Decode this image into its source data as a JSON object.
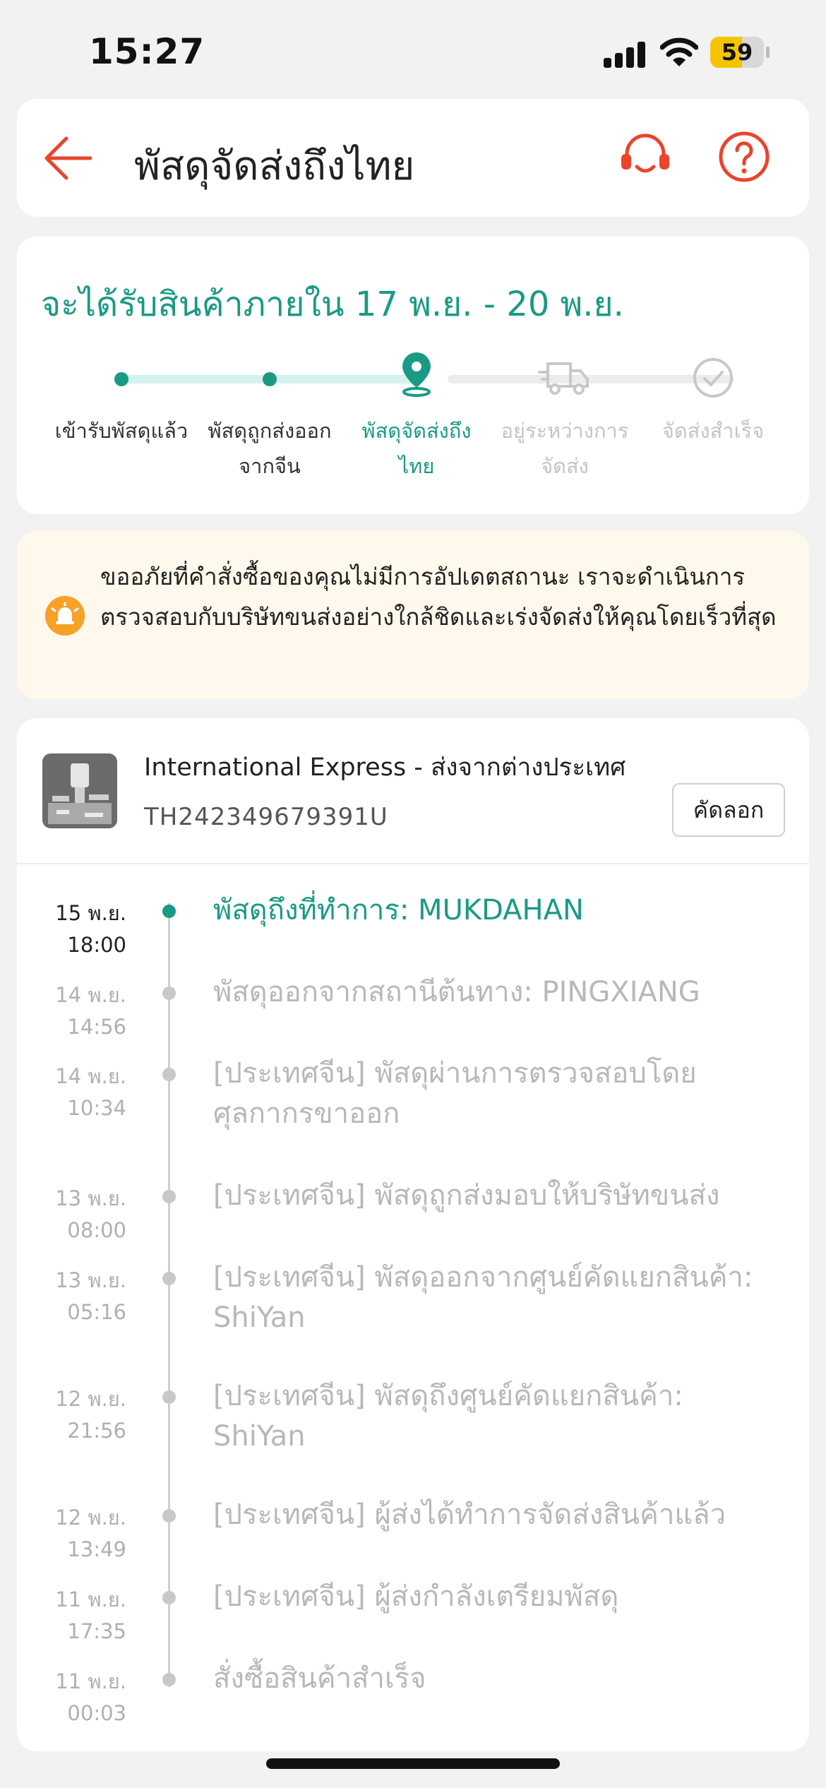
{
  "status_bar": {
    "time": "15:27",
    "battery": "59",
    "battery_level": 0.59
  },
  "header": {
    "title": "พัสดุจัดส่งถึงไทย"
  },
  "delivery": {
    "eta": "จะได้รับสินค้าภายใน 17 พ.ย. - 20 พ.ย.",
    "steps": [
      {
        "label_1": "เข้ารับพัสดุแล้ว",
        "label_2": "",
        "state": "done"
      },
      {
        "label_1": "พัสดุถูกส่งออก",
        "label_2": "จากจีน",
        "state": "done"
      },
      {
        "label_1": "พัสดุจัดส่งถึง",
        "label_2": "ไทย",
        "state": "current"
      },
      {
        "label_1": "อยู่ระหว่างการ",
        "label_2": "จัดส่ง",
        "state": "future"
      },
      {
        "label_1": "จัดส่งสำเร็จ",
        "label_2": "",
        "state": "future"
      }
    ]
  },
  "notice": {
    "text": "ขออภัยที่คำสั่งซื้อของคุณไม่มีการอัปเดตสถานะ เราจะดำเนินการตรวจสอบกับบริษัทขนส่งอย่างใกล้ชิดและเร่งจัดส่งให้คุณโดยเร็วที่สุด"
  },
  "shipment": {
    "carrier": "International Express - ส่งจากต่างประเทศ",
    "tracking_number": "TH242349679391U",
    "copy_label": "คัดลอก"
  },
  "events": [
    {
      "day": "15 พ.ย.",
      "time": "18:00",
      "description": "พัสดุถึงที่ทำการ: MUKDAHAN",
      "active": true
    },
    {
      "day": "14 พ.ย.",
      "time": "14:56",
      "description": "พัสดุออกจากสถานีต้นทาง: PINGXIANG",
      "active": false
    },
    {
      "day": "14 พ.ย.",
      "time": "10:34",
      "description": "[ประเทศจีน] พัสดุผ่านการตรวจสอบโดยศุลกากรขาออก",
      "active": false
    },
    {
      "day": "13 พ.ย.",
      "time": "08:00",
      "description": "[ประเทศจีน] พัสดุถูกส่งมอบให้บริษัทขนส่ง",
      "active": false
    },
    {
      "day": "13 พ.ย.",
      "time": "05:16",
      "description": "[ประเทศจีน] พัสดุออกจากศูนย์คัดแยกสินค้า: ShiYan",
      "active": false
    },
    {
      "day": "12 พ.ย.",
      "time": "21:56",
      "description": "[ประเทศจีน] พัสดุถึงศูนย์คัดแยกสินค้า: ShiYan",
      "active": false
    },
    {
      "day": "12 พ.ย.",
      "time": "13:49",
      "description": "[ประเทศจีน] ผู้ส่งได้ทำการจัดส่งสินค้าแล้ว",
      "active": false
    },
    {
      "day": "11 พ.ย.",
      "time": "17:35",
      "description": "[ประเทศจีน] ผู้ส่งกำลังเตรียมพัสดุ",
      "active": false
    },
    {
      "day": "11 พ.ย.",
      "time": "00:03",
      "description": "สั่งซื้อสินค้าสำเร็จ",
      "active": false
    }
  ]
}
